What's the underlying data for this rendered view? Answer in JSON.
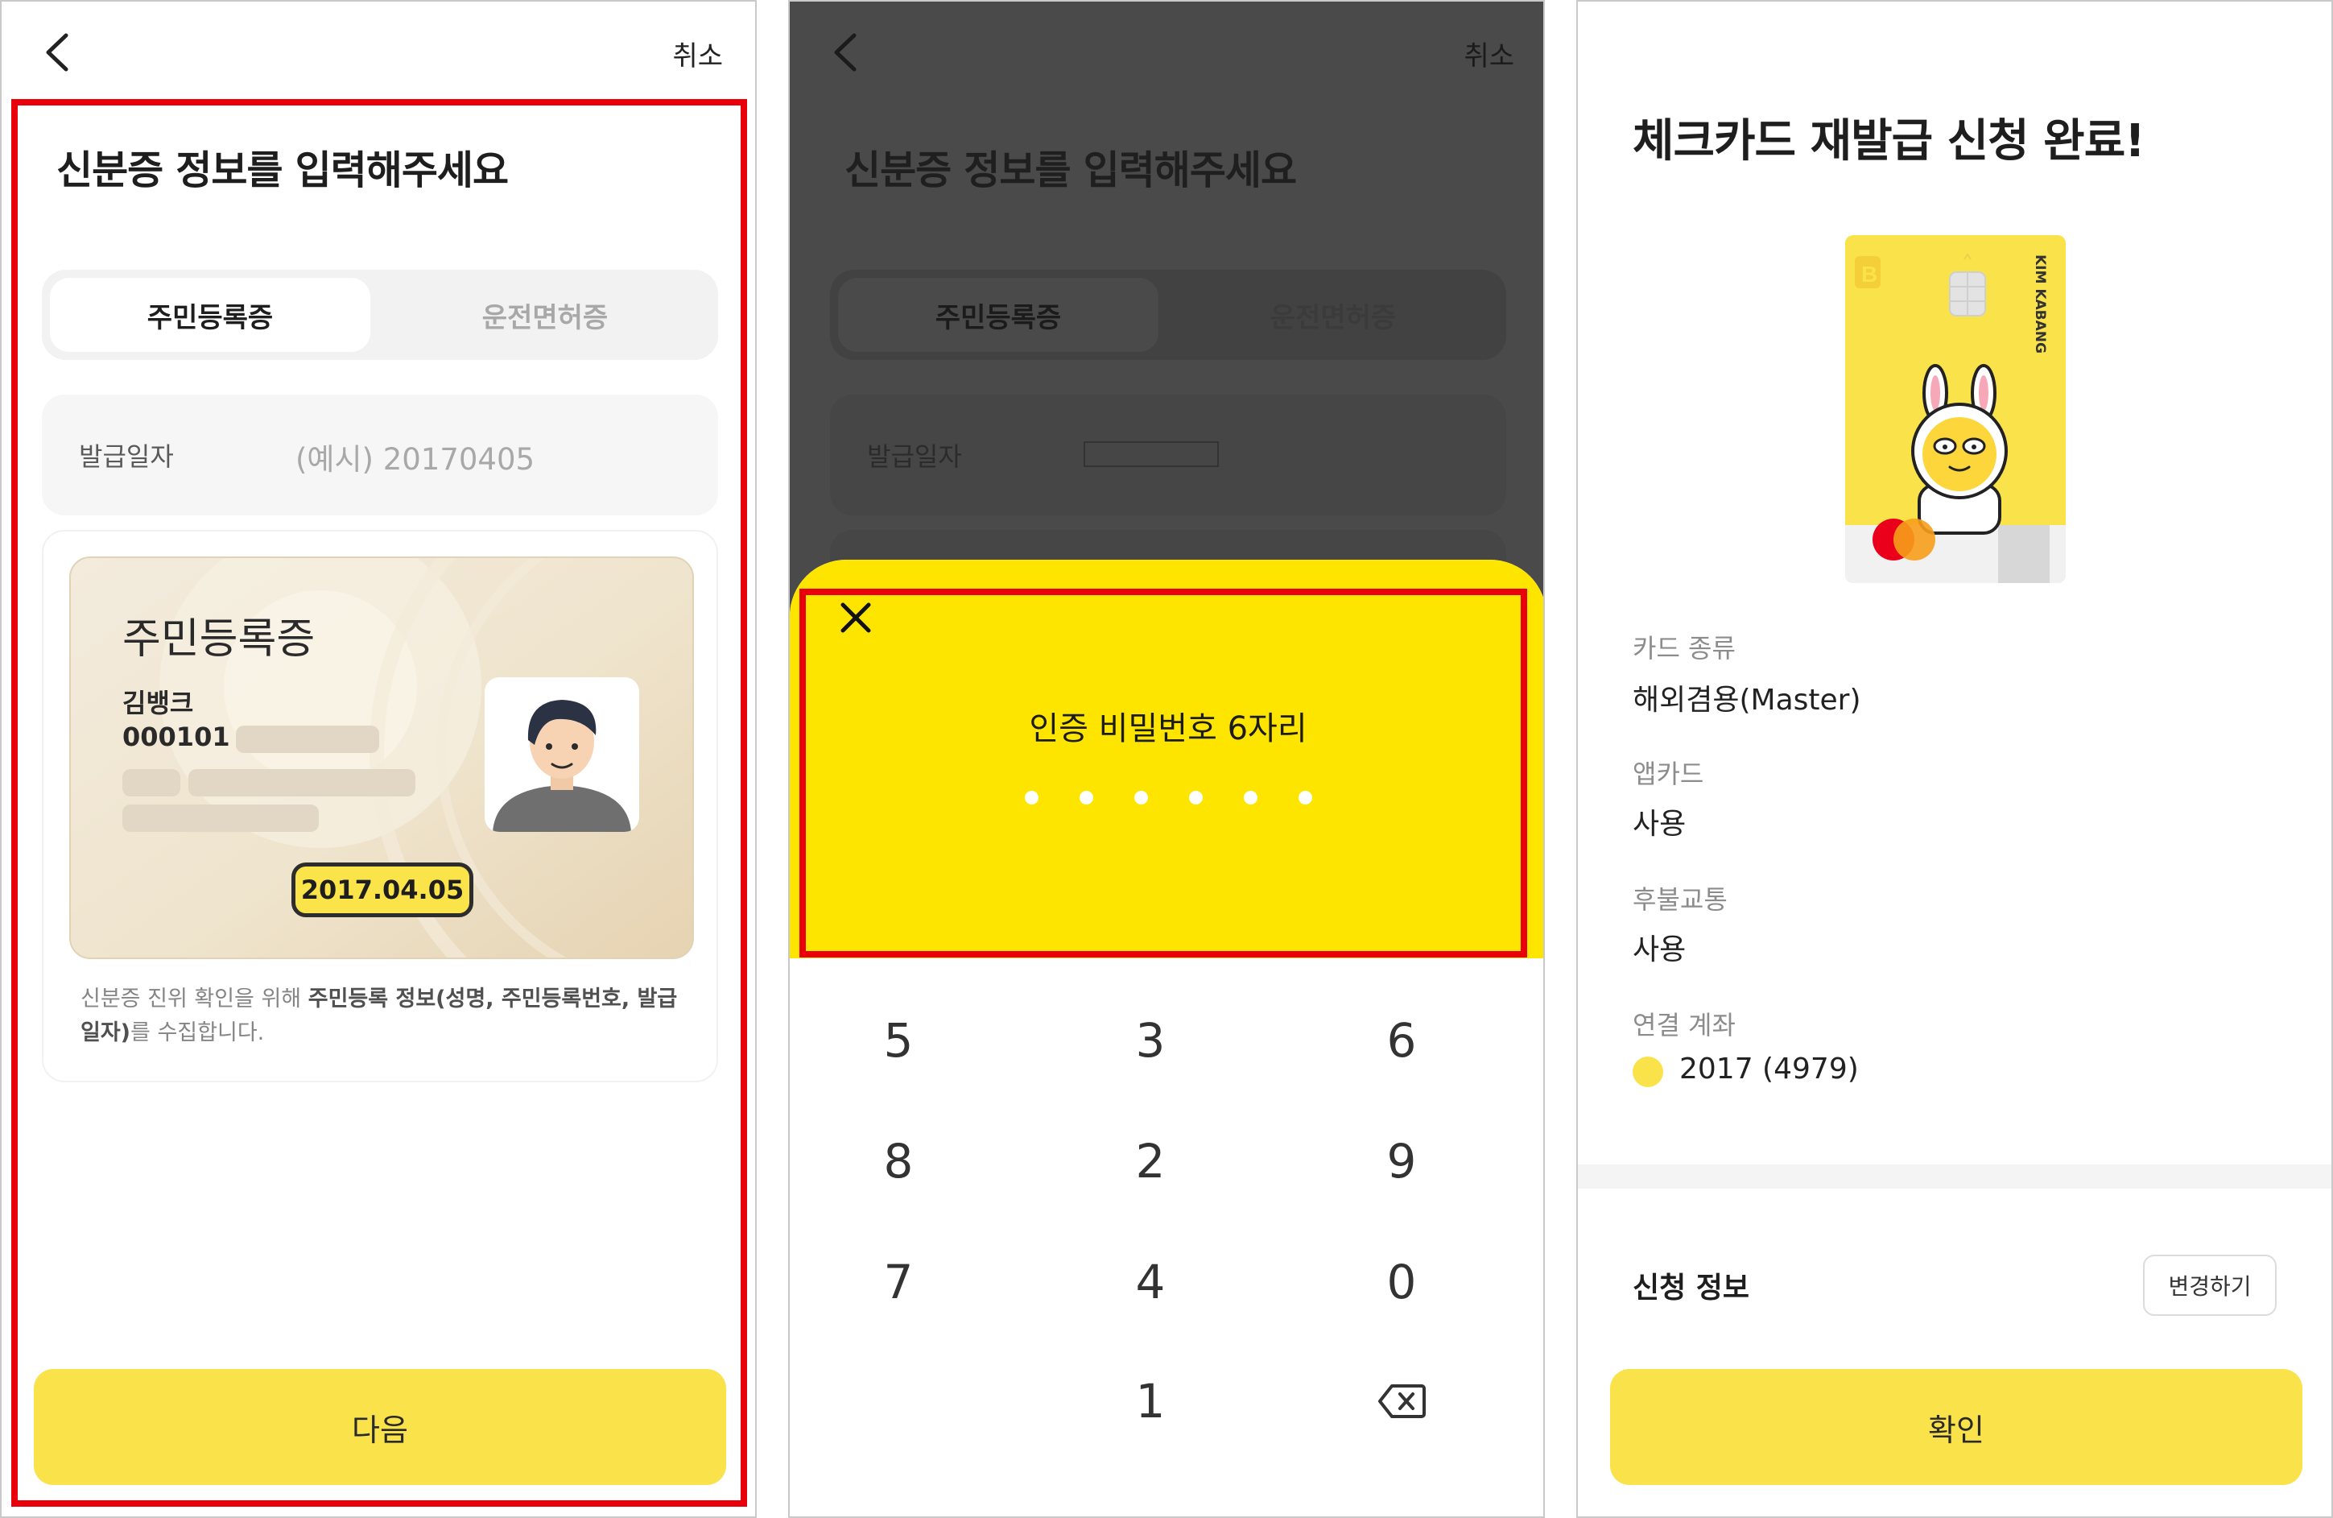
{
  "screens": {
    "id_input": {
      "cancel_label": "취소",
      "title": "신분증 정보를 입력해주세요",
      "tabs": [
        {
          "label": "주민등록증",
          "selected": true
        },
        {
          "label": "운전면허증",
          "selected": false
        }
      ],
      "issue_date_label": "발급일자",
      "issue_date_placeholder": "(예시) 20170405",
      "card_sample": {
        "title": "주민등록증",
        "name": "김뱅크",
        "number_prefix": "000101 -",
        "issue_date": "2017.04.05"
      },
      "notice_prefix": "신분증 진위 확인을 위해 ",
      "notice_bold": "주민등록 정보(성명, 주민등록번호, 발급일자)",
      "notice_suffix": "를 수집합니다.",
      "next_label": "다음"
    },
    "pin_entry": {
      "cancel_label": "취소",
      "title": "신분증 정보를 입력해주세요",
      "tabs": [
        {
          "label": "주민등록증",
          "selected": true
        },
        {
          "label": "운전면허증",
          "selected": false
        }
      ],
      "issue_date_label": "발급일자",
      "sheet_title": "인증 비밀번호 6자리",
      "digits_entered": 0,
      "digits_total": 6,
      "keypad": [
        "5",
        "3",
        "6",
        "8",
        "2",
        "9",
        "7",
        "4",
        "0",
        "",
        "1",
        "backspace-icon"
      ]
    },
    "complete": {
      "title": "체크카드 재발급 신청 완료!",
      "card_name": "KIM KABANG",
      "details": [
        {
          "label": "카드 종류",
          "value": "해외겸용(Master)"
        },
        {
          "label": "앱카드",
          "value": "사용"
        },
        {
          "label": "후불교통",
          "value": "사용"
        },
        {
          "label": "연결 계좌",
          "value": "2017 (4979)"
        }
      ],
      "section_title": "신청 정보",
      "change_label": "변경하기",
      "confirm_label": "확인"
    }
  },
  "colors": {
    "accent_yellow": "#fae24b",
    "sheet_yellow": "#fee500",
    "highlight_red": "#e8000b",
    "dim_overlay": "#4a4a4a"
  }
}
